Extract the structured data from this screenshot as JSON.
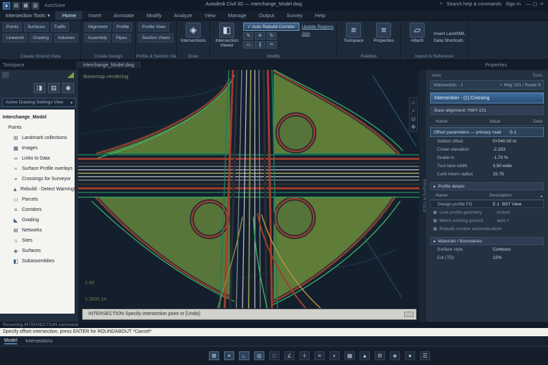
{
  "colors": {
    "accent_blue": "#3e6d9e",
    "road_red": "#a33d2c",
    "patch_green": "#5f7c39",
    "edge_green": "#3fae5c",
    "canvas_bg": "#141f2d"
  },
  "titlebar": {
    "quick_access_icons": [
      "app-icon",
      "new-icon",
      "open-icon",
      "save-icon"
    ],
    "autosave_label": "AutoSave",
    "document_title": "Autodesk Civil 3D — Interchange_Model.dwg",
    "search_label": "Search help & commands",
    "signin_label": "Sign In",
    "window_controls": [
      "—",
      "▢",
      "×"
    ]
  },
  "ribbon": {
    "workspace_label": "Intersection Tools",
    "tabs": [
      {
        "label": "Home",
        "active": true
      },
      {
        "label": "Insert",
        "active": false
      },
      {
        "label": "Annotate",
        "active": false
      },
      {
        "label": "Modify",
        "active": false
      },
      {
        "label": "Analyze",
        "active": false
      },
      {
        "label": "View",
        "active": false
      },
      {
        "label": "Manage",
        "active": false
      },
      {
        "label": "Output",
        "active": false
      },
      {
        "label": "Survey",
        "active": false
      },
      {
        "label": "Help",
        "active": false
      }
    ],
    "groups": [
      {
        "kind": "grid",
        "label": "Create Ground Data",
        "rows": [
          [
            "Points",
            "Surfaces",
            "Traffic"
          ],
          [
            "Linework",
            "Grading",
            "Volumes"
          ]
        ]
      },
      {
        "kind": "grid",
        "label": "Create Design",
        "rows": [
          [
            "Alignment",
            "Profile"
          ],
          [
            "Assembly",
            "Pipes"
          ]
        ]
      },
      {
        "kind": "grid",
        "label": "Profile & Section Views",
        "rows": [
          [
            "Profile View"
          ],
          [
            "Section Views"
          ]
        ]
      },
      {
        "kind": "big",
        "label": "Draw",
        "big": {
          "label": "Intersections",
          "icon": "road-icon"
        }
      },
      {
        "kind": "modify",
        "label": "Modify",
        "big": {
          "label": "Intersection Viewer",
          "icon": "camera-icon"
        },
        "toggle": "Auto Rebuild Corridor",
        "icon_grid": [
          "edit-icon",
          "move-icon",
          "rotate-icon",
          "erase-icon",
          "offset-icon",
          "trim-icon"
        ],
        "links": [
          "Update Regions",
          "Join"
        ]
      },
      {
        "kind": "twobig",
        "label": "Palettes",
        "buttons": [
          {
            "label": "Toolspace",
            "icon": "stack-icon"
          },
          {
            "label": "Properties",
            "icon": "stack-icon"
          }
        ]
      },
      {
        "kind": "bigtext",
        "label": "Import & Reference",
        "big": {
          "label": "Attach",
          "icon": "file-icon"
        },
        "lines": [
          "Insert LandXML",
          "Data Shortcuts"
        ]
      }
    ]
  },
  "docbar": {
    "panel_caption": "Toolspace",
    "drawing_tab": "Interchange_Model.dwg",
    "right_caption": "Properties"
  },
  "toolspace": {
    "toolbar_icons": [
      "save-view-icon",
      "open-view-icon",
      "refresh-icon"
    ],
    "view_selector": "Active Drawing Settings View",
    "tree": {
      "root": "Interchange_Model",
      "sub_root": "Points",
      "items": [
        {
          "label": "Landmark collections",
          "icon": "point-groups-icon"
        },
        {
          "label": "Images",
          "icon": "image-icon"
        },
        {
          "label": "Links to Data",
          "icon": "link-icon"
        },
        {
          "label": "Surface Profile overlays",
          "icon": "surface-icon"
        },
        {
          "label": "Crossings for Surveyor",
          "icon": "survey-icon"
        },
        {
          "label": "Rebuild - Detect Warnings",
          "icon": "warning-icon"
        },
        {
          "label": "Parcels",
          "icon": "parcel-icon"
        },
        {
          "label": "Corridors",
          "icon": "corridor-icon"
        },
        {
          "label": "Grading",
          "icon": "grading-icon"
        },
        {
          "label": "Networks",
          "icon": "network-icon"
        },
        {
          "label": "Sites",
          "icon": "site-icon"
        },
        {
          "label": "Surfaces",
          "icon": "surfaces-icon"
        },
        {
          "label": "Subassemblies",
          "icon": "subassembly-icon"
        }
      ]
    }
  },
  "canvas": {
    "viewport_label": "Basemap rendering",
    "scale_labels": [
      "1:40",
      "1:3000.14"
    ],
    "command_strip": "INTERSECTION  Specify intersection point or [Undo]:",
    "nav_icons": [
      "home-icon",
      "zoom-icon",
      "orbit-icon",
      "pan-icon"
    ]
  },
  "properties": {
    "spine_label": "PROPERTIES",
    "mini_left": "View",
    "mini_right": "Tools",
    "header_left": "Intersection - 1",
    "header_right": "+ Hwy 101 / Route 9",
    "selected_item": "Intersection - (1) Crossing",
    "secondary_item": "Base alignment: HWY-101",
    "table_headers": [
      "Name",
      "Value",
      "Data"
    ],
    "sort_glyph": "▴",
    "highlight_row": {
      "name": "Offset parameters — primary road",
      "value": "S-1"
    },
    "rows": [
      {
        "name": "Station offset",
        "value": "0+040.00 m"
      },
      {
        "name": "Crown elevation",
        "value": "-2.253"
      },
      {
        "name": "Grade in",
        "value": "-1.70 %"
      },
      {
        "name": "Turn lane width",
        "value": "3.50 wide"
      },
      {
        "name": "Curb return radius",
        "value": "15.75"
      }
    ],
    "section2": "Profile details",
    "sub_headers": [
      "Name",
      "Description"
    ],
    "sub_row": {
      "name": "Design profile FG",
      "value": "E-1",
      "extra": "BST View"
    },
    "checks": [
      {
        "name": "Lock profile geometry",
        "value": "locked"
      },
      {
        "name": "Match existing ground",
        "value": "auto +"
      },
      {
        "name": "Rebuild corridor automatically",
        "value": "on"
      }
    ],
    "section3": "Materials / Boundaries",
    "rows2": [
      {
        "name": "Surface style",
        "value": "Contours"
      },
      {
        "name": "Cut (TD)",
        "value": "12%"
      }
    ]
  },
  "commandline": {
    "history": "Resuming INTERSECTION command.",
    "prompt": "Specify offset intersection, press ENTER for ROUNDABOUT  *Cancel*"
  },
  "layout_tabs": [
    {
      "label": "Model",
      "active": true
    },
    {
      "label": "Intersections",
      "active": false
    }
  ],
  "statusbar": {
    "icons": [
      "grid-icon",
      "snap-icon",
      "ortho-icon",
      "polar-icon",
      "osnap-icon",
      "otrack-icon",
      "dynamic-input-icon",
      "lineweight-icon",
      "transparency-icon",
      "selection-cycling-icon",
      "annotation-scale-icon",
      "workspace-gear-icon",
      "units-icon",
      "isolate-icon",
      "customize-icon"
    ]
  }
}
